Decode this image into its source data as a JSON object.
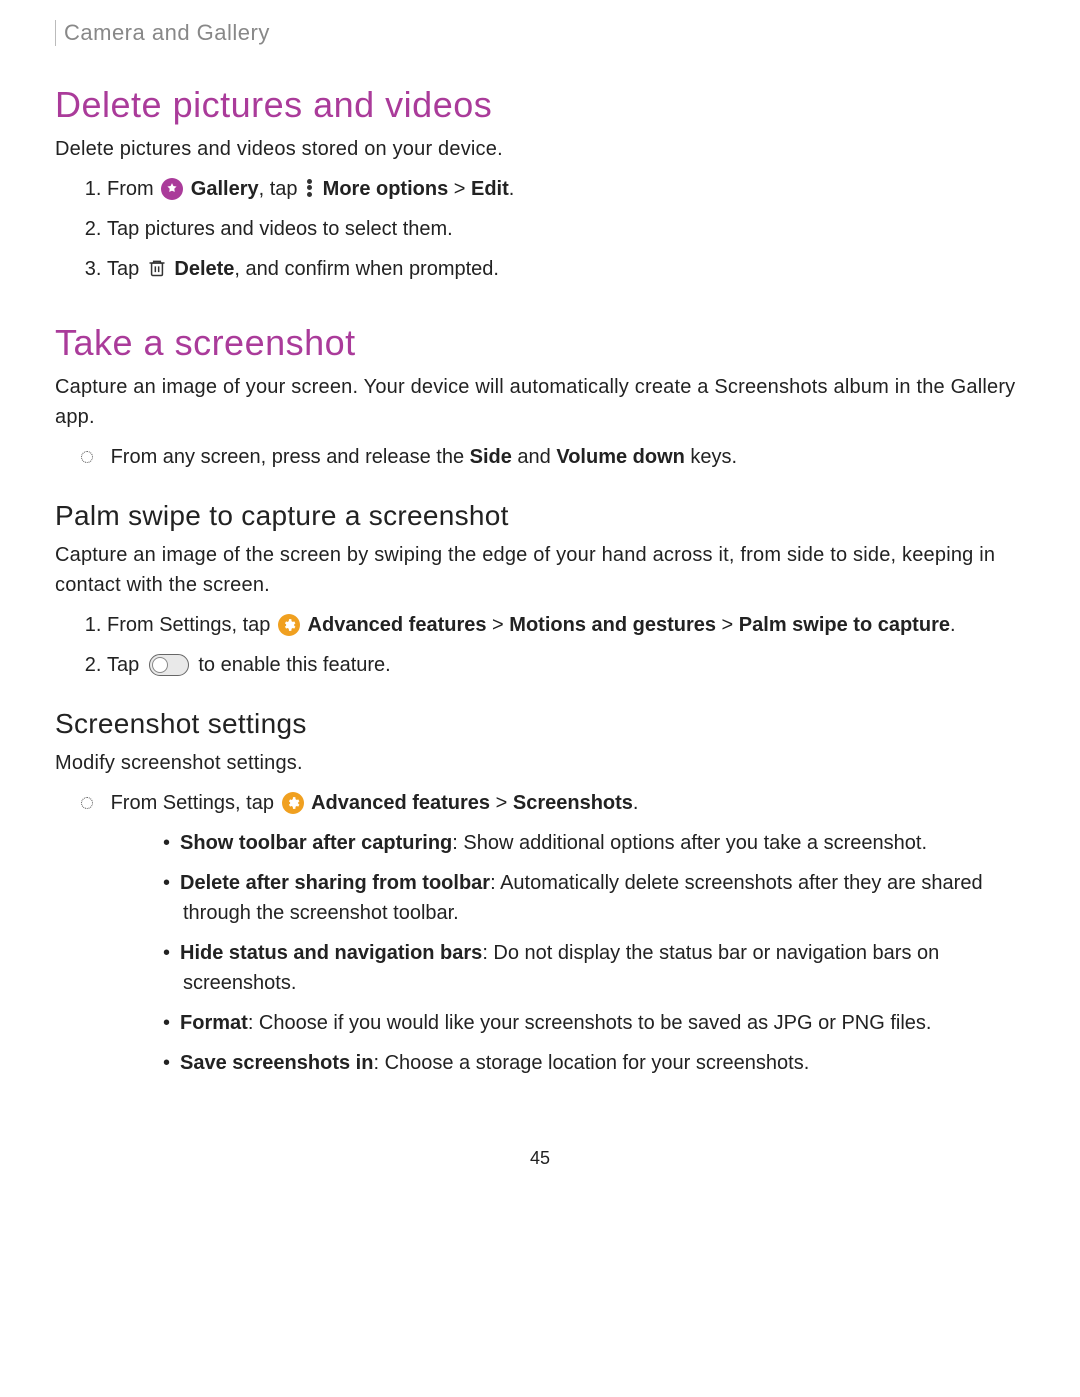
{
  "breadcrumb": "Camera and Gallery",
  "section1": {
    "title": "Delete pictures and videos",
    "intro": "Delete pictures and videos stored on your device.",
    "step1_prefix": "From ",
    "gallery_label": "Gallery",
    "step1_mid": ", tap ",
    "more_options": "More options",
    "breadcrumb_sep": " > ",
    "edit": "Edit",
    "step2": "Tap pictures and videos to select them.",
    "step3_prefix": "Tap ",
    "delete": "Delete",
    "step3_suffix": ", and confirm when prompted."
  },
  "section2": {
    "title": "Take a screenshot",
    "intro": "Capture an image of your screen. Your device will automatically create a Screenshots album in the Gallery app.",
    "bullet_prefix": "From any screen, press and release the ",
    "side": "Side",
    "and": " and ",
    "voldown": "Volume down",
    "bullet_suffix": " keys."
  },
  "section3": {
    "title": "Palm swipe to capture a screenshot",
    "intro": "Capture an image of the screen by swiping the edge of your hand across it, from side to side, keeping in contact with the screen.",
    "step1_prefix": "From Settings, tap ",
    "adv": "Advanced features",
    "sep": " > ",
    "motions": "Motions and gestures",
    "palm": "Palm swipe to capture",
    "step2_prefix": "Tap ",
    "step2_suffix": " to enable this feature."
  },
  "section4": {
    "title": "Screenshot settings",
    "intro": "Modify screenshot settings.",
    "bullet_prefix": "From Settings, tap ",
    "adv": "Advanced features",
    "sep": " > ",
    "screenshots": "Screenshots",
    "items": [
      {
        "label": "Show toolbar after capturing",
        "desc": ": Show additional options after you take a screenshot."
      },
      {
        "label": "Delete after sharing from toolbar",
        "desc": ": Automatically delete screenshots after they are shared through the screenshot toolbar."
      },
      {
        "label": "Hide status and navigation bars",
        "desc": ": Do not display the status bar or navigation bars on screenshots."
      },
      {
        "label": "Format",
        "desc": ": Choose if you would like your screenshots to be saved as JPG or PNG files."
      },
      {
        "label": "Save screenshots in",
        "desc": ": Choose a storage location for your screenshots."
      }
    ]
  },
  "page_number": "45"
}
